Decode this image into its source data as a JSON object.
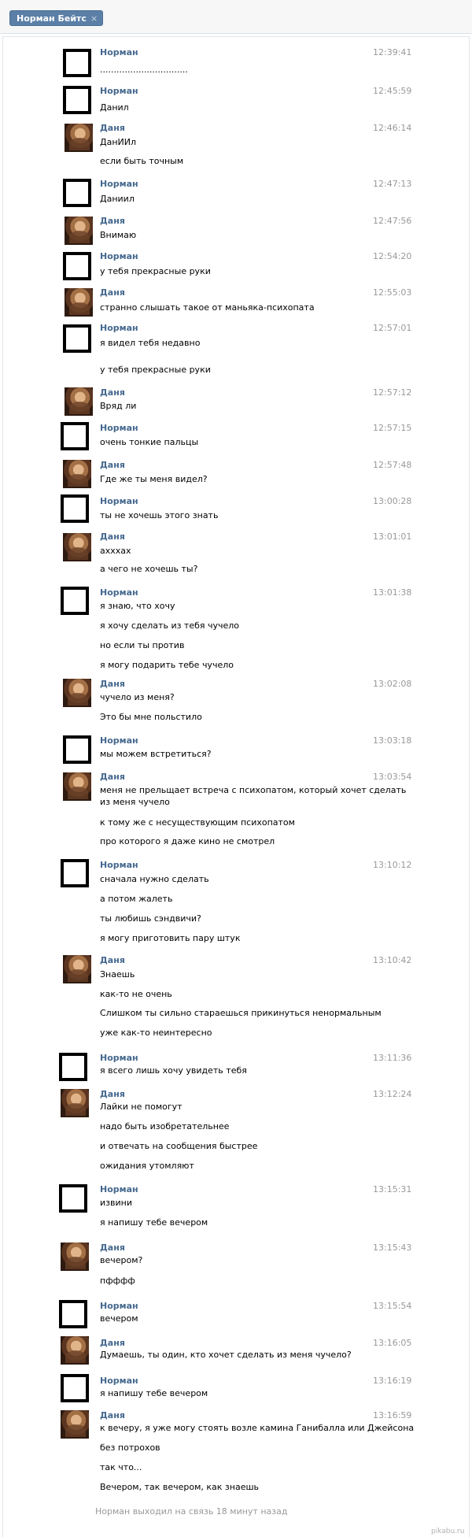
{
  "tab": {
    "title": "Норман Бейтс",
    "close_glyph": "×"
  },
  "messages": [
    {
      "author": "Норман",
      "time": "12:39:41",
      "avatar": "black-square-outline",
      "lines": [
        "................................"
      ]
    },
    {
      "author": "Норман",
      "time": "12:45:59",
      "avatar": "black-square-outline",
      "lines": [
        "Данил"
      ]
    },
    {
      "author": "Даня",
      "time": "12:46:14",
      "avatar": "photo",
      "lines": [
        "ДанИИл",
        "если быть точным"
      ]
    },
    {
      "author": "Норман",
      "time": "12:47:13",
      "avatar": "black-square-outline",
      "lines": [
        "Даниил"
      ]
    },
    {
      "author": "Даня",
      "time": "12:47:56",
      "avatar": "photo",
      "lines": [
        "Внимаю"
      ]
    },
    {
      "author": "Норман",
      "time": "12:54:20",
      "avatar": "black-square-outline",
      "lines": [
        "у тебя прекрасные руки"
      ]
    },
    {
      "author": "Даня",
      "time": "12:55:03",
      "avatar": "photo",
      "lines": [
        "странно слышать такое от маньяка-психопата"
      ]
    },
    {
      "author": "Норман",
      "time": "12:57:01",
      "avatar": "black-square-outline",
      "lines": [
        "я видел тебя недавно",
        "у тебя прекрасные руки"
      ]
    },
    {
      "author": "Даня",
      "time": "12:57:12",
      "avatar": "photo",
      "lines": [
        "Вряд ли"
      ]
    },
    {
      "author": "Норман",
      "time": "12:57:15",
      "avatar": "black-square-outline",
      "lines": [
        "очень тонкие пальцы"
      ]
    },
    {
      "author": "Даня",
      "time": "12:57:48",
      "avatar": "photo",
      "lines": [
        "Где же ты меня видел?"
      ]
    },
    {
      "author": "Норман",
      "time": "13:00:28",
      "avatar": "black-square-outline",
      "lines": [
        "ты не хочешь этого знать"
      ]
    },
    {
      "author": "Даня",
      "time": "13:01:01",
      "avatar": "photo",
      "lines": [
        "ахххах",
        "а чего не хочешь ты?"
      ]
    },
    {
      "author": "Норман",
      "time": "13:01:38",
      "avatar": "black-square-outline",
      "lines": [
        "я знаю, что хочу",
        "я хочу сделать из тебя чучело",
        "но если ты против",
        "я могу подарить тебе чучело"
      ]
    },
    {
      "author": "Даня",
      "time": "13:02:08",
      "avatar": "photo",
      "lines": [
        "чучело из меня?",
        "Это бы мне польстило"
      ]
    },
    {
      "author": "Норман",
      "time": "13:03:18",
      "avatar": "black-square-outline",
      "lines": [
        "мы можем встретиться?"
      ]
    },
    {
      "author": "Даня",
      "time": "13:03:54",
      "avatar": "photo",
      "lines": [
        "меня не прельщает встреча с психопатом, который хочет сделать",
        "из меня чучело",
        "к тому же с несуществующим психопатом",
        "про которого я даже кино не смотрел"
      ]
    },
    {
      "author": "Норман",
      "time": "13:10:12",
      "avatar": "black-square-outline",
      "lines": [
        "сначала нужно сделать",
        "а потом жалеть",
        "ты любишь сэндвичи?",
        "я могу приготовить пару штук"
      ]
    },
    {
      "author": "Даня",
      "time": "13:10:42",
      "avatar": "photo",
      "lines": [
        "Знаешь",
        "как-то не очень",
        "Слишком ты сильно стараешься прикинуться ненормальным",
        "уже как-то неинтересно"
      ]
    },
    {
      "author": "Норман",
      "time": "13:11:36",
      "avatar": "black-square-outline",
      "lines": [
        "я всего лишь хочу увидеть тебя"
      ]
    },
    {
      "author": "Даня",
      "time": "13:12:24",
      "avatar": "photo",
      "lines": [
        "Лайки не помогут",
        "надо быть изобретательнее",
        "и отвечать на сообщения быстрее",
        "ожидания утомляют"
      ]
    },
    {
      "author": "Норман",
      "time": "13:15:31",
      "avatar": "black-square-outline",
      "lines": [
        "извини",
        "я напишу тебе вечером"
      ]
    },
    {
      "author": "Даня",
      "time": "13:15:43",
      "avatar": "photo",
      "lines": [
        "вечером?",
        "пфффф"
      ]
    },
    {
      "author": "Норман",
      "time": "13:15:54",
      "avatar": "black-square-outline",
      "lines": [
        "вечером"
      ]
    },
    {
      "author": "Даня",
      "time": "13:16:05",
      "avatar": "photo",
      "lines": [
        "Думаешь, ты один, кто хочет сделать из меня чучело?"
      ]
    },
    {
      "author": "Норман",
      "time": "13:16:19",
      "avatar": "black-square-outline",
      "lines": [
        "я напишу тебе вечером"
      ]
    },
    {
      "author": "Даня",
      "time": "13:16:59",
      "avatar": "photo",
      "lines": [
        "к вечеру, я уже могу стоять возле камина Ганибалла или Джейсона",
        "без потрохов",
        "так что...",
        "Вечером, так вечером, как знаешь"
      ]
    }
  ],
  "status_text": "Норман выходил на связь 18 минут назад",
  "watermark": "pikabu.ru",
  "colors": {
    "author": "#45688e",
    "time": "#999999",
    "tab_bg": "#5b7fa6"
  }
}
